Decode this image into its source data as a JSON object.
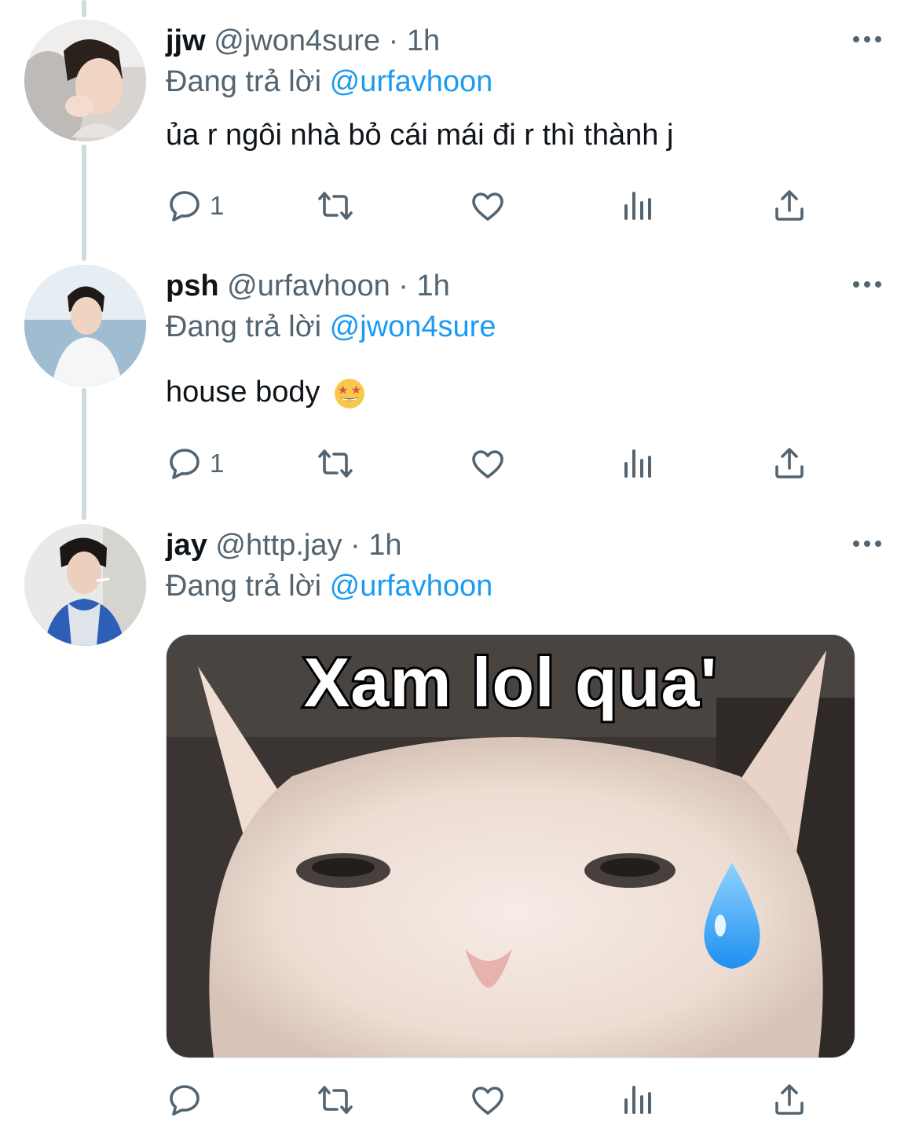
{
  "tweets": [
    {
      "name": "jjw",
      "handle": "@jwon4sure",
      "dot": "·",
      "time": "1h",
      "reply_prefix": "Đang trả lời",
      "reply_to": "@urfavhoon",
      "text": "ủa r ngôi nhà bỏ cái mái đi r thì thành j",
      "reply_count": "1",
      "retweet_count": "",
      "like_count": ""
    },
    {
      "name": "psh",
      "handle": "@urfavhoon",
      "dot": "·",
      "time": "1h",
      "reply_prefix": "Đang trả lời",
      "reply_to": "@jwon4sure",
      "text": "house body",
      "emoji": "star-struck-emoji",
      "reply_count": "1",
      "retweet_count": "",
      "like_count": ""
    },
    {
      "name": "jay",
      "handle": "@http.jay",
      "dot": "·",
      "time": "1h",
      "reply_prefix": "Đang trả lời",
      "reply_to": "@urfavhoon",
      "media_caption": "Xam lol qua'",
      "reply_count": "",
      "retweet_count": "",
      "like_count": ""
    }
  ],
  "icons": {
    "reply": "reply-icon",
    "retweet": "retweet-icon",
    "like": "heart-icon",
    "analytics": "analytics-icon",
    "share": "share-icon",
    "more": "more-options-icon"
  },
  "colors": {
    "text": "#0f1419",
    "secondary": "#536471",
    "mention": "#1d9bf0",
    "thread_line": "#cfd9de"
  }
}
